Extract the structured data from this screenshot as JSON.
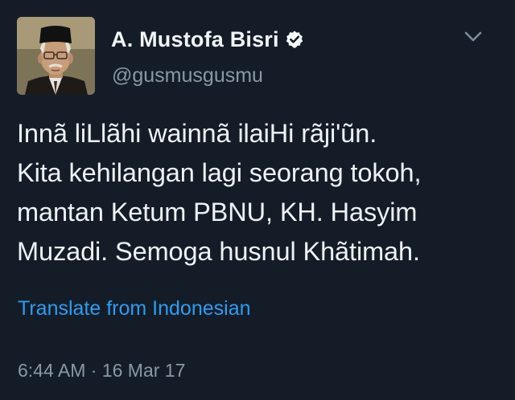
{
  "author": {
    "display_name": "A. Mustofa Bisri",
    "handle": "@gusmusgusmu",
    "verified": true,
    "avatar_icon": "profile-photo"
  },
  "tweet": {
    "lines": [
      "Innã liLlãhi wainnã ilaiHi rãji'ũn.",
      "Kita kehilangan lagi seorang tokoh,",
      "mantan Ketum PBNU, KH. Hasyim",
      "Muzadi. Semoga husnul Khãtimah."
    ],
    "translate_label": "Translate from Indonesian",
    "timestamp": "6:44 AM · 16 Mar 17"
  },
  "colors": {
    "background": "#141d27",
    "link": "#2a9df4",
    "secondary_text": "#8899a6"
  }
}
